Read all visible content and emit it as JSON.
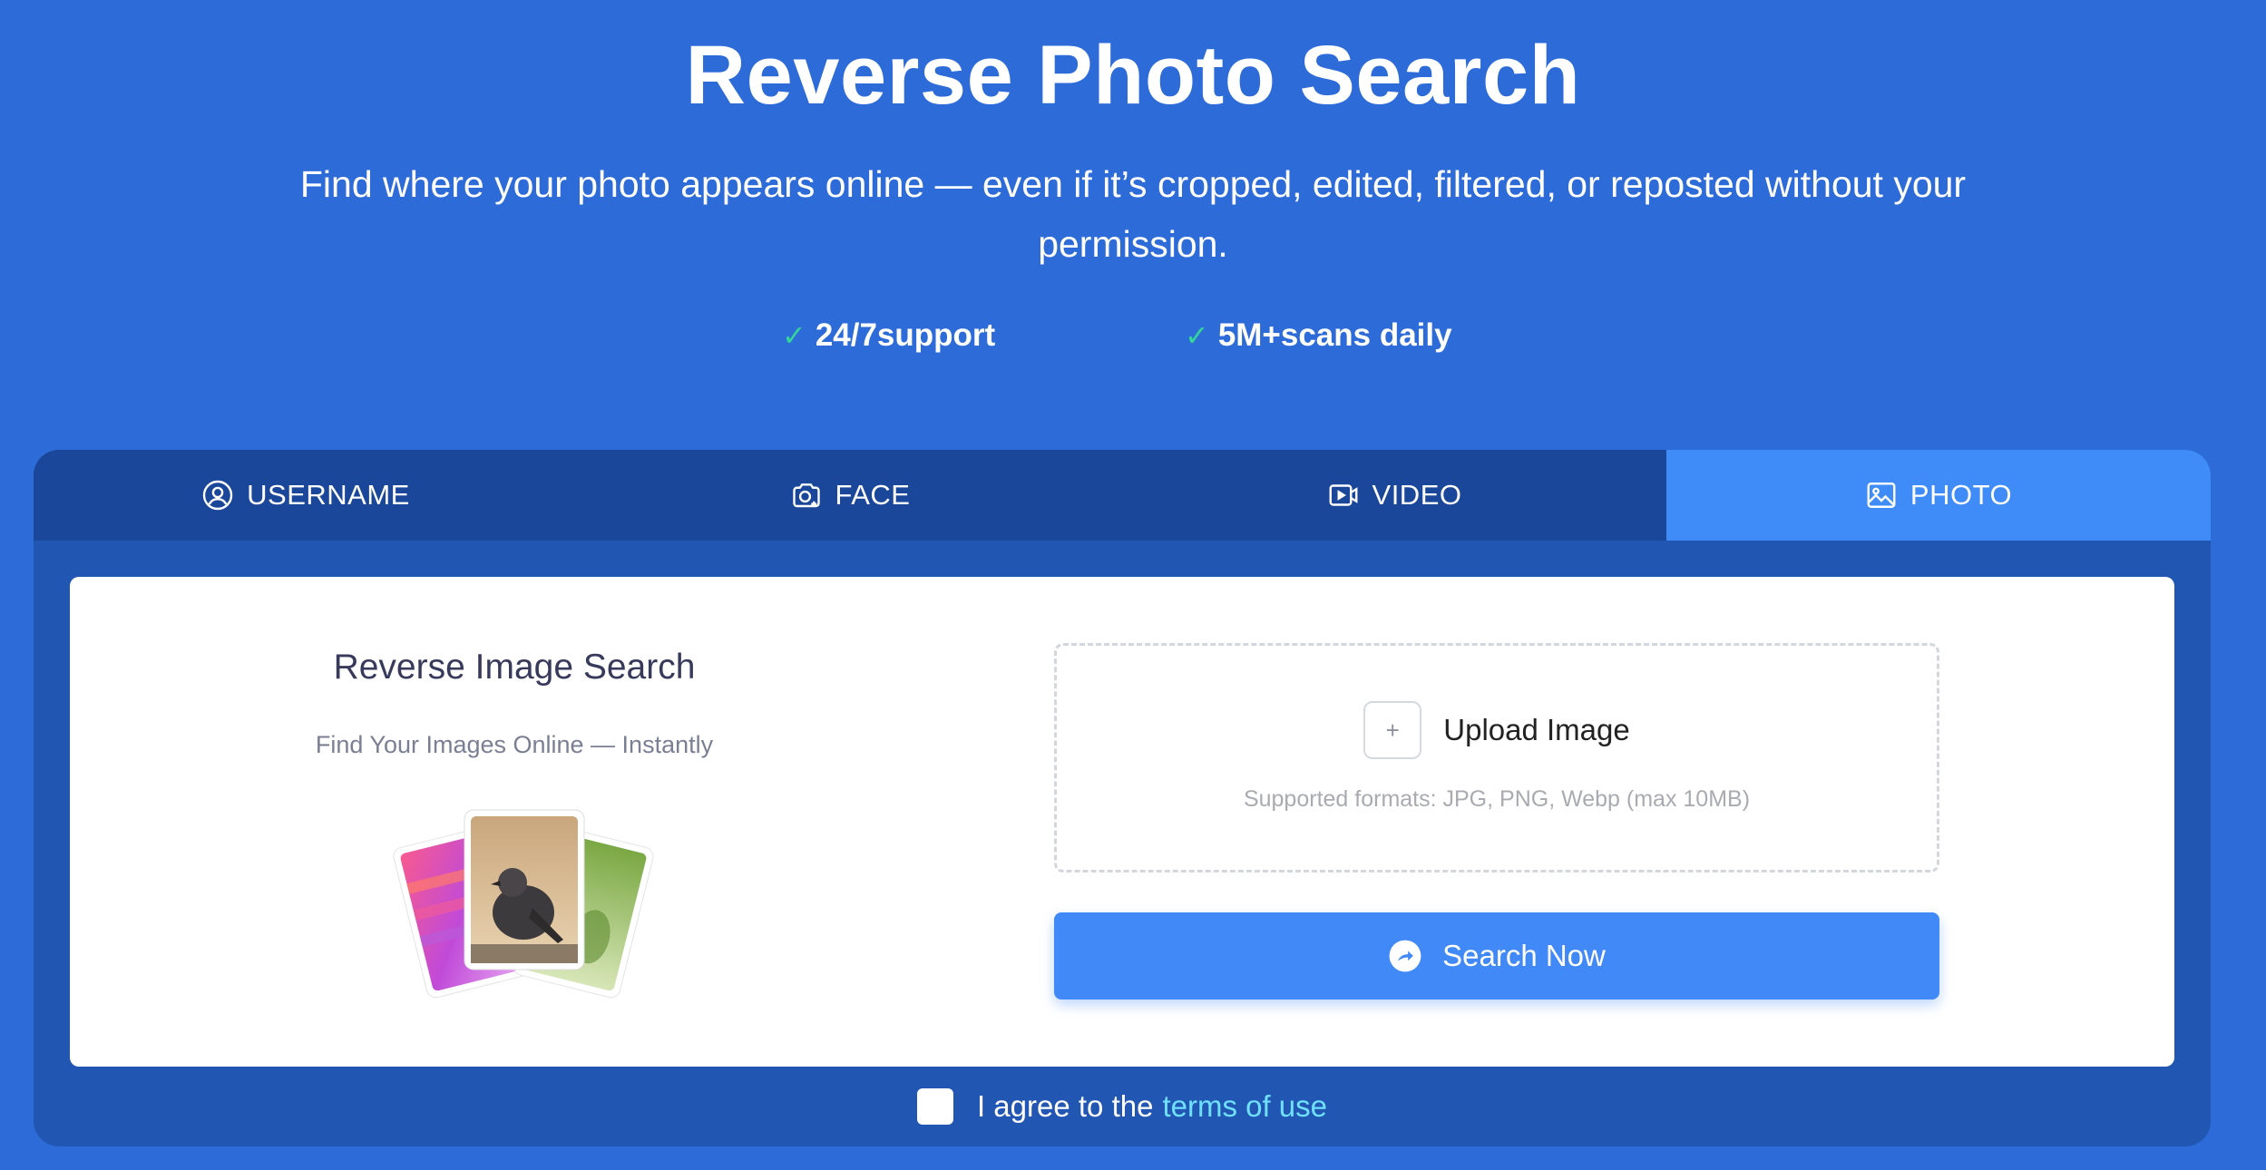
{
  "hero": {
    "title": "Reverse Photo Search",
    "subtitle": "Find where your photo appears online — even if it’s cropped, edited, filtered, or reposted without your permission.",
    "features": [
      {
        "icon": "check-icon",
        "label": "24/7support"
      },
      {
        "icon": "check-icon",
        "label": "5M+scans daily"
      }
    ]
  },
  "tabs": [
    {
      "icon": "user-circle-icon",
      "label": "USERNAME",
      "active": false
    },
    {
      "icon": "camera-icon",
      "label": "FACE",
      "active": false
    },
    {
      "icon": "video-icon",
      "label": "VIDEO",
      "active": false
    },
    {
      "icon": "image-icon",
      "label": "PHOTO",
      "active": true
    }
  ],
  "card": {
    "title": "Reverse Image Search",
    "subtitle": "Find Your Images Online — Instantly",
    "illustration": "photos-stack-illustration",
    "upload": {
      "icon": "plus-icon",
      "label": "Upload Image",
      "formats": "Supported formats: JPG, PNG, Webp (max 10MB)"
    },
    "search_button": {
      "icon": "arrow-circle-icon",
      "label": "Search Now"
    }
  },
  "agreement": {
    "checked": false,
    "text": "I agree to the",
    "link": "terms of use"
  },
  "colors": {
    "background": "#2d6bd9",
    "panel": "#2256b3",
    "tab_bar": "#1a4799",
    "active_tab": "#3f8cf8",
    "button": "#4189f7",
    "check": "#34d399",
    "link": "#6fe0ff"
  }
}
